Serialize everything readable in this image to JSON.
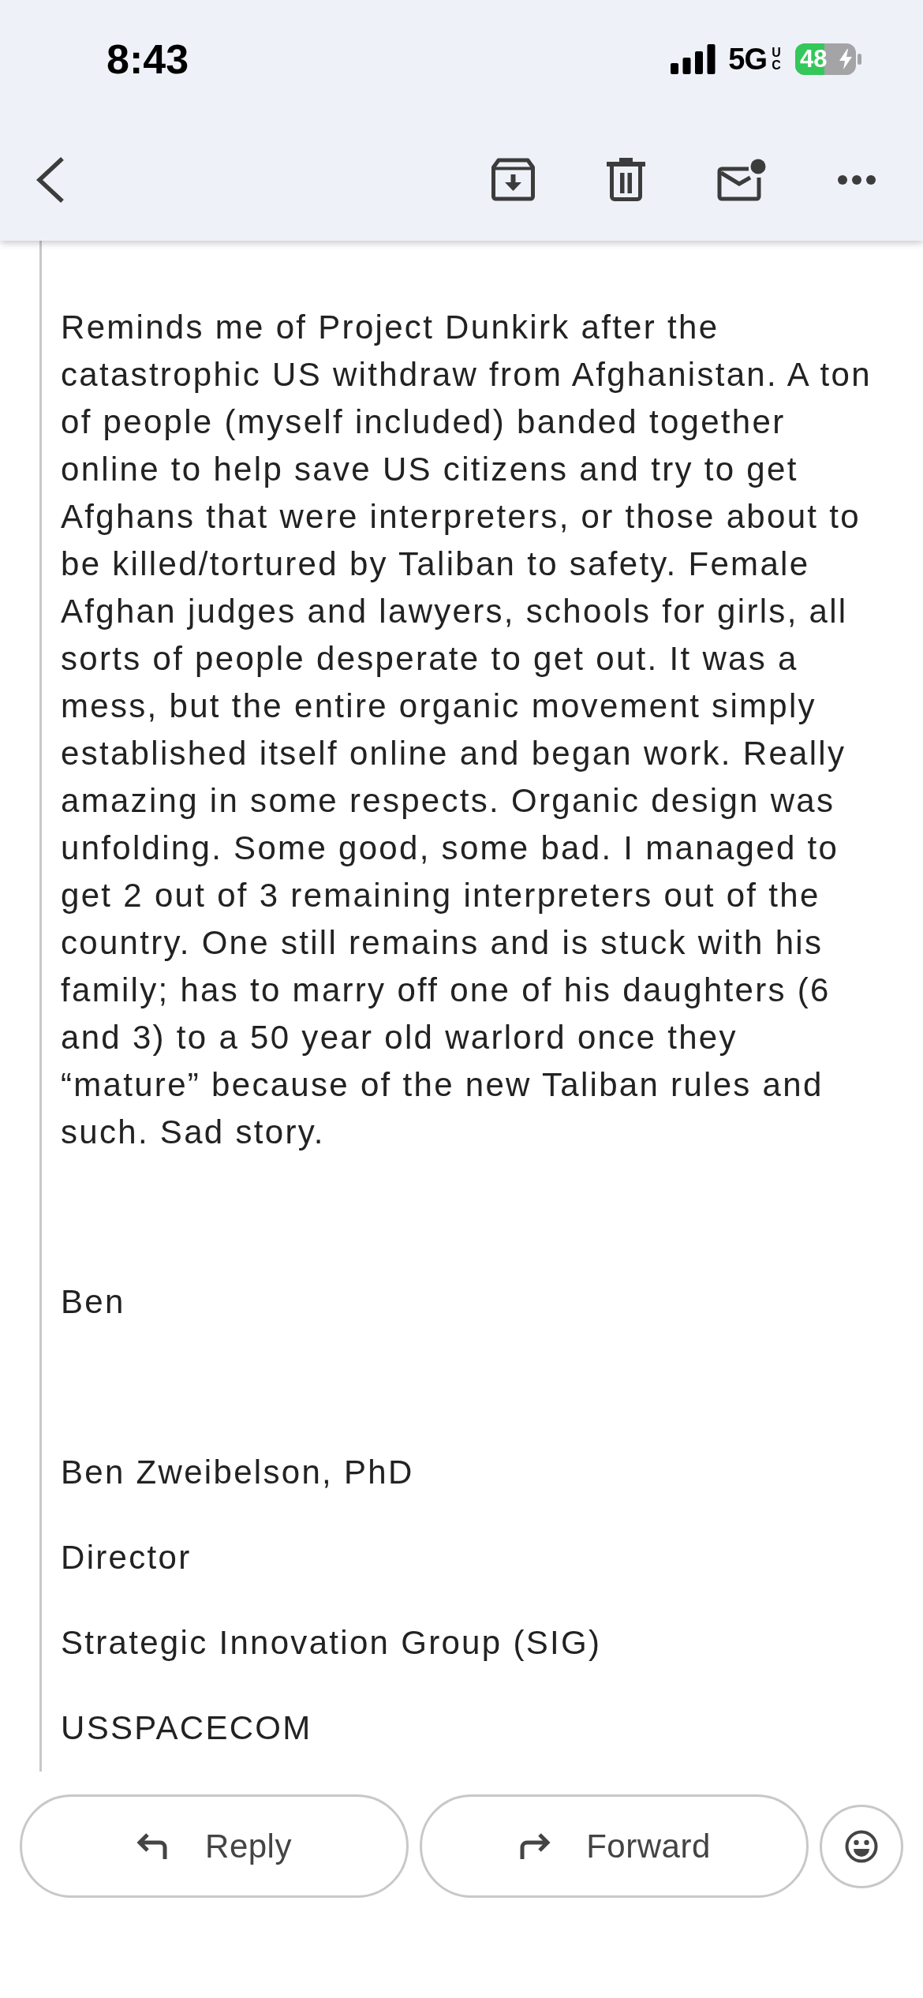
{
  "status_bar": {
    "time": "8:43",
    "network": "5G",
    "network_suffix": "UC",
    "battery": "48",
    "charging": true
  },
  "message": {
    "paragraphs": [
      "Reminds me of Project Dunkirk after the catastrophic US withdraw from Afghanistan. A ton of people (myself included) banded together online to help save US citizens and try to get Afghans that were interpreters, or those about to be killed/tortured by Taliban to safety. Female Afghan judges and lawyers, schools for girls, all sorts of people desperate to get out. It was a mess, but the entire organic movement simply established itself online and began work. Really amazing in some respects. Organic design was unfolding. Some good, some bad. I managed to get 2 out of 3 remaining interpreters out of the country. One still remains and is stuck with his family; has to marry off one of his daughters (6 and 3) to a 50 year old warlord once they “mature” because of the new Taliban rules and such. Sad story."
    ],
    "signoff": "Ben",
    "signature": [
      "Ben Zweibelson, PhD",
      "Director",
      "Strategic Innovation Group (SIG)",
      "USSPACECOM"
    ]
  },
  "actions": [
    {
      "kind": "reply",
      "label": "Reply"
    },
    {
      "kind": "forward",
      "label": "Forward"
    },
    {
      "kind": "react"
    }
  ]
}
